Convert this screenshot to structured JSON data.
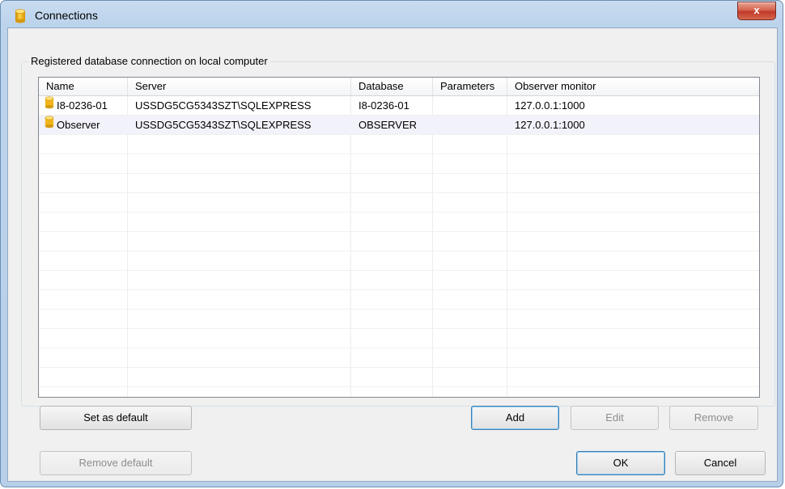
{
  "window": {
    "title": "Connections",
    "close_label": "x"
  },
  "group": {
    "legend": "Registered database connection on local computer"
  },
  "list": {
    "columns": [
      "Name",
      "Server",
      "Database",
      "Parameters",
      "Observer monitor"
    ],
    "rows": [
      {
        "icon": "database-icon",
        "name": "I8-0236-01",
        "server": "USSDG5CG5343SZT\\SQLEXPRESS",
        "database": "I8-0236-01",
        "parameters": "",
        "monitor": "127.0.0.1:1000"
      },
      {
        "icon": "database-icon",
        "name": "Observer",
        "server": "USSDG5CG5343SZT\\SQLEXPRESS",
        "database": "OBSERVER",
        "parameters": "",
        "monitor": "127.0.0.1:1000"
      }
    ]
  },
  "buttons": {
    "set_default": "Set as default",
    "add": "Add",
    "edit": "Edit",
    "remove": "Remove",
    "remove_default": "Remove default",
    "ok": "OK",
    "cancel": "Cancel"
  },
  "colors": {
    "frame": "#b7cfe9",
    "close": "#c0392a",
    "alt_row": "#f2f2fa"
  }
}
